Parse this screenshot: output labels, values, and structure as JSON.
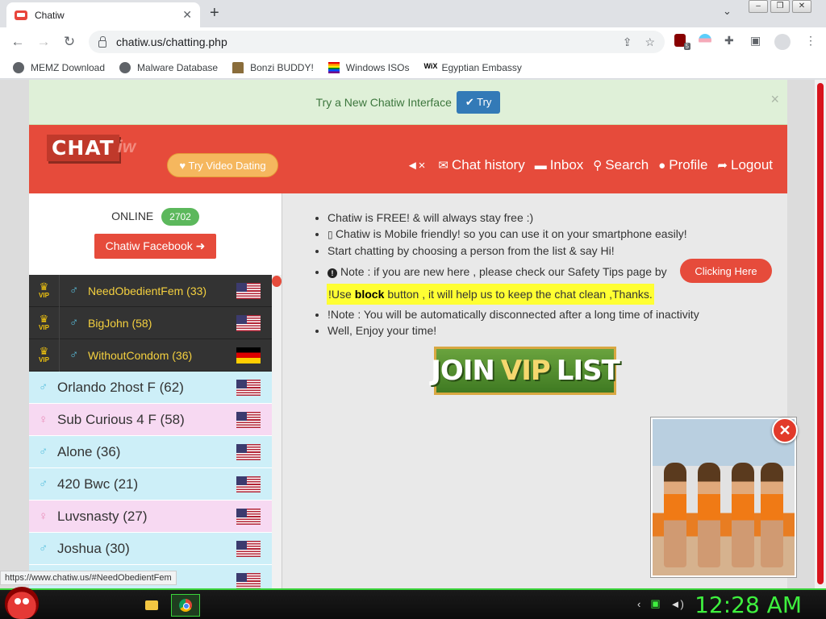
{
  "browser": {
    "tab_title": "Chatiw",
    "url": "chatiw.us/chatting.php",
    "ext_badge": "5",
    "bookmarks": [
      "MEMZ Download",
      "Malware Database",
      "Bonzi BUDDY!",
      "Windows ISOs",
      "Egyptian Embassy"
    ]
  },
  "notice": {
    "text": "Try a New Chatiw Interface",
    "button": "✔ Try",
    "close": "×"
  },
  "header": {
    "logo_chat": "CHAT",
    "logo_iw": "iw",
    "video_button": "♥ Try Video Dating",
    "nav": [
      {
        "icon": "◄×",
        "label": ""
      },
      {
        "icon": "✉",
        "label": "Chat history"
      },
      {
        "icon": "▬",
        "label": "Inbox"
      },
      {
        "icon": "⚲",
        "label": "Search"
      },
      {
        "icon": "●",
        "label": "Profile"
      },
      {
        "icon": "➦",
        "label": "Logout"
      }
    ]
  },
  "sidebar": {
    "online_label": "ONLINE",
    "online_count": "2702",
    "facebook_button": "Chatiw Facebook ➜",
    "vip_tag": "VIP",
    "users": [
      {
        "name": "NeedObedientFem (33)",
        "kind": "vip",
        "gender_icon": "♂",
        "flag": "us"
      },
      {
        "name": "BigJohn (58)",
        "kind": "vip",
        "gender_icon": "♂",
        "flag": "us"
      },
      {
        "name": "WithoutCondom (36)",
        "kind": "vip",
        "gender_icon": "♂",
        "flag": "de"
      },
      {
        "name": "Orlando 2host F (62)",
        "kind": "male",
        "gender_icon": "♂",
        "flag": "us"
      },
      {
        "name": "Sub Curious 4 F (58)",
        "kind": "female",
        "gender_icon": "♀",
        "flag": "us"
      },
      {
        "name": "Alone (36)",
        "kind": "male",
        "gender_icon": "♂",
        "flag": "us"
      },
      {
        "name": "420 Bwc (21)",
        "kind": "male",
        "gender_icon": "♂",
        "flag": "us"
      },
      {
        "name": "Luvsnasty (27)",
        "kind": "female",
        "gender_icon": "♀",
        "flag": "us"
      },
      {
        "name": "Joshua (30)",
        "kind": "male",
        "gender_icon": "♂",
        "flag": "us"
      },
      {
        "name": "",
        "kind": "male",
        "gender_icon": "♂",
        "flag": "us"
      }
    ]
  },
  "content": {
    "bullets": [
      "Chatiw is FREE! & will always stay free :)",
      "Chatiw is Mobile friendly! so you can use it on your smartphone easily!",
      "Start chatting by choosing a person from the list & say Hi!",
      "Note : if you are new here , please check our Safety Tips page by"
    ],
    "clicking_here": "Clicking Here",
    "highlight_pre": "Use",
    "highlight_bold": "block",
    "highlight_post": "button , it will help us to keep the chat clean ,Thanks.",
    "bullets2": [
      "Note : You will be automatically disconnected after a long time of inactivity",
      "Well, Enjoy your time!"
    ],
    "vip_banner": {
      "a": "JOIN",
      "b": "VIP",
      "c": "LIST"
    }
  },
  "ad": {
    "close": "✕"
  },
  "status_url": "https://www.chatiw.us/#NeedObedientFem",
  "taskbar": {
    "clock": "12:28 AM"
  }
}
